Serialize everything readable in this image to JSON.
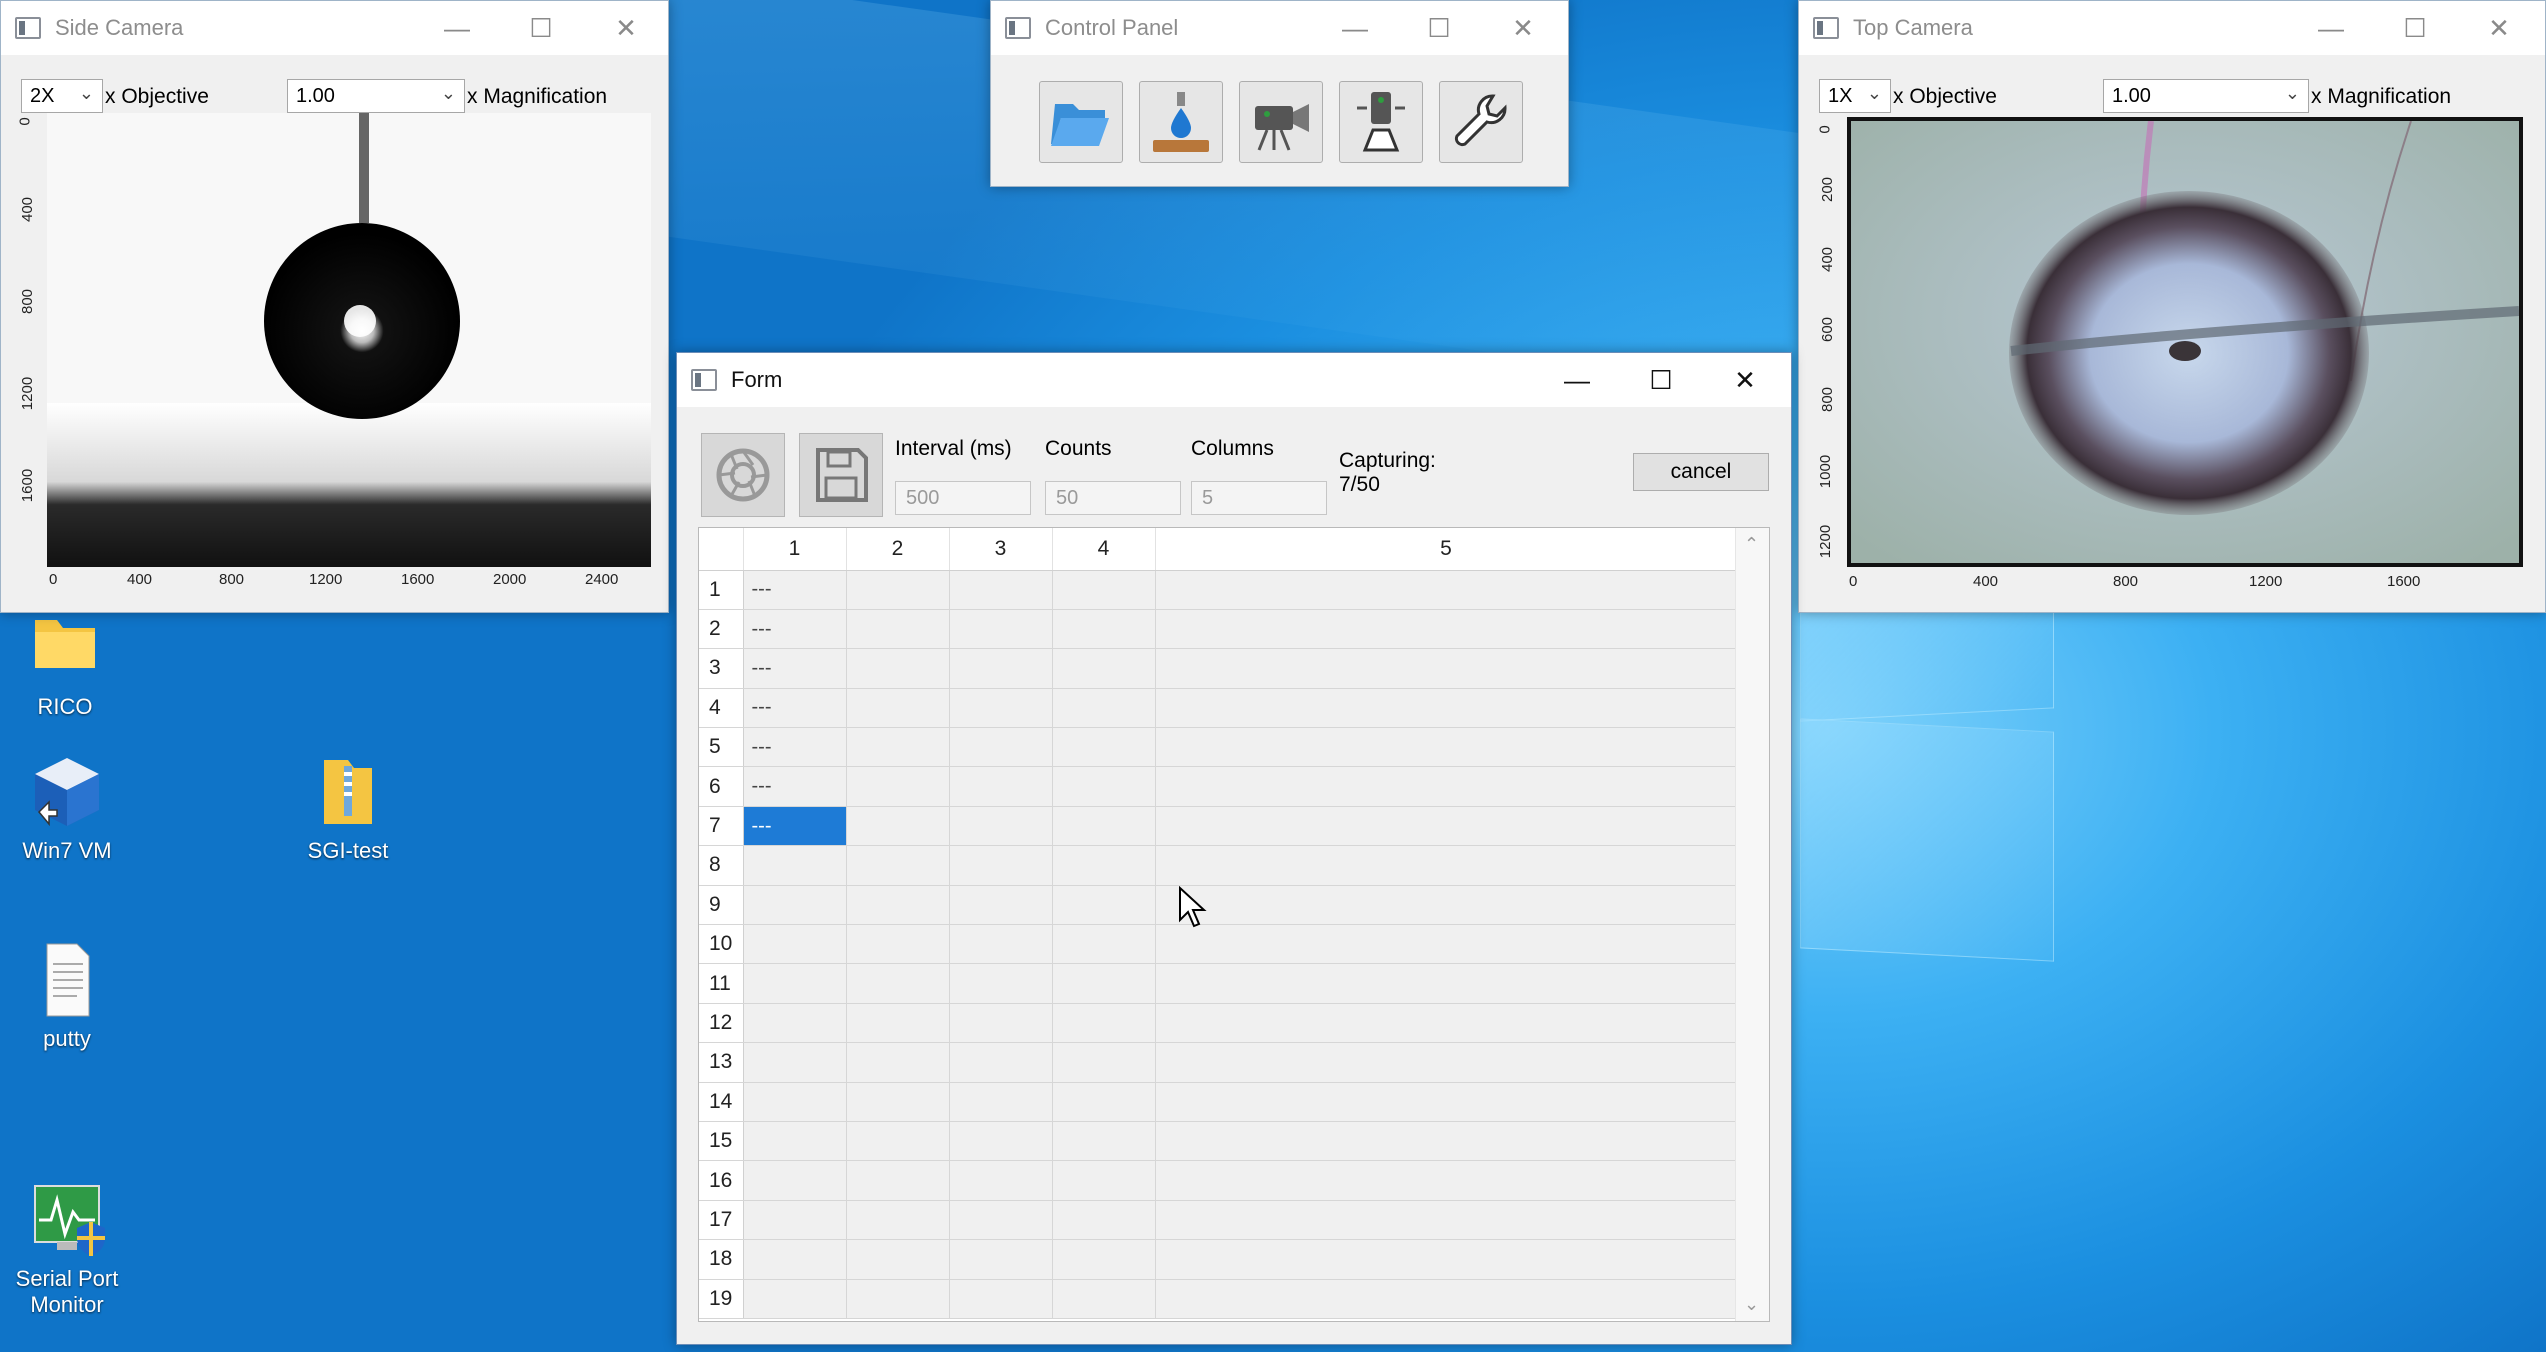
{
  "desktop": {
    "icons": [
      {
        "label": "RICO",
        "icon": "folder-icon"
      },
      {
        "label": "Win7 VM",
        "icon": "virtualbox-icon"
      },
      {
        "label": "SGI-test",
        "icon": "zip-folder-icon"
      },
      {
        "label": "putty",
        "icon": "document-icon"
      },
      {
        "label": "Serial Port\nMonitor",
        "icon": "serial-monitor-icon"
      }
    ]
  },
  "side_camera": {
    "title": "Side Camera",
    "objective_value": "2X",
    "objective_label": "x Objective",
    "magnification_value": "1.00",
    "magnification_label": "x Magnification",
    "x_ticks": [
      "0",
      "400",
      "800",
      "1200",
      "1600",
      "2000",
      "2400"
    ],
    "y_ticks": [
      "0",
      "400",
      "800",
      "1200",
      "1600"
    ]
  },
  "control_panel": {
    "title": "Control Panel",
    "buttons": [
      "open-folder-icon",
      "dispense-drop-icon",
      "video-camera-icon",
      "camera-stage-icon",
      "wrench-icon"
    ]
  },
  "top_camera": {
    "title": "Top Camera",
    "objective_value": "1X",
    "objective_label": "x Objective",
    "magnification_value": "1.00",
    "magnification_label": "x Magnification",
    "x_ticks": [
      "0",
      "400",
      "800",
      "1200",
      "1600"
    ],
    "y_ticks": [
      "0",
      "200",
      "400",
      "600",
      "800",
      "1000",
      "1200"
    ]
  },
  "form": {
    "title": "Form",
    "interval_label": "Interval (ms)",
    "interval_value": "500",
    "counts_label": "Counts",
    "counts_value": "50",
    "columns_label": "Columns",
    "columns_value": "5",
    "capturing_label": "Capturing:",
    "capturing_value": "7/50",
    "cancel_label": "cancel",
    "table": {
      "columns": [
        "1",
        "2",
        "3",
        "4",
        "5"
      ],
      "rows": [
        [
          "1",
          "---",
          "",
          "",
          "",
          ""
        ],
        [
          "2",
          "---",
          "",
          "",
          "",
          ""
        ],
        [
          "3",
          "---",
          "",
          "",
          "",
          ""
        ],
        [
          "4",
          "---",
          "",
          "",
          "",
          ""
        ],
        [
          "5",
          "---",
          "",
          "",
          "",
          ""
        ],
        [
          "6",
          "---",
          "",
          "",
          "",
          ""
        ],
        [
          "7",
          "---",
          "",
          "",
          "",
          ""
        ],
        [
          "8",
          "",
          "",
          "",
          "",
          ""
        ],
        [
          "9",
          "",
          "",
          "",
          "",
          ""
        ],
        [
          "10",
          "",
          "",
          "",
          "",
          ""
        ],
        [
          "11",
          "",
          "",
          "",
          "",
          ""
        ],
        [
          "12",
          "",
          "",
          "",
          "",
          ""
        ],
        [
          "13",
          "",
          "",
          "",
          "",
          ""
        ],
        [
          "14",
          "",
          "",
          "",
          "",
          ""
        ],
        [
          "15",
          "",
          "",
          "",
          "",
          ""
        ],
        [
          "16",
          "",
          "",
          "",
          "",
          ""
        ],
        [
          "17",
          "",
          "",
          "",
          "",
          ""
        ],
        [
          "18",
          "",
          "",
          "",
          "",
          ""
        ],
        [
          "19",
          "",
          "",
          "",
          "",
          ""
        ]
      ],
      "selected_row": 7
    }
  },
  "colors": {
    "selection": "#1e7bd6",
    "desktop": "#1a8fdc"
  }
}
